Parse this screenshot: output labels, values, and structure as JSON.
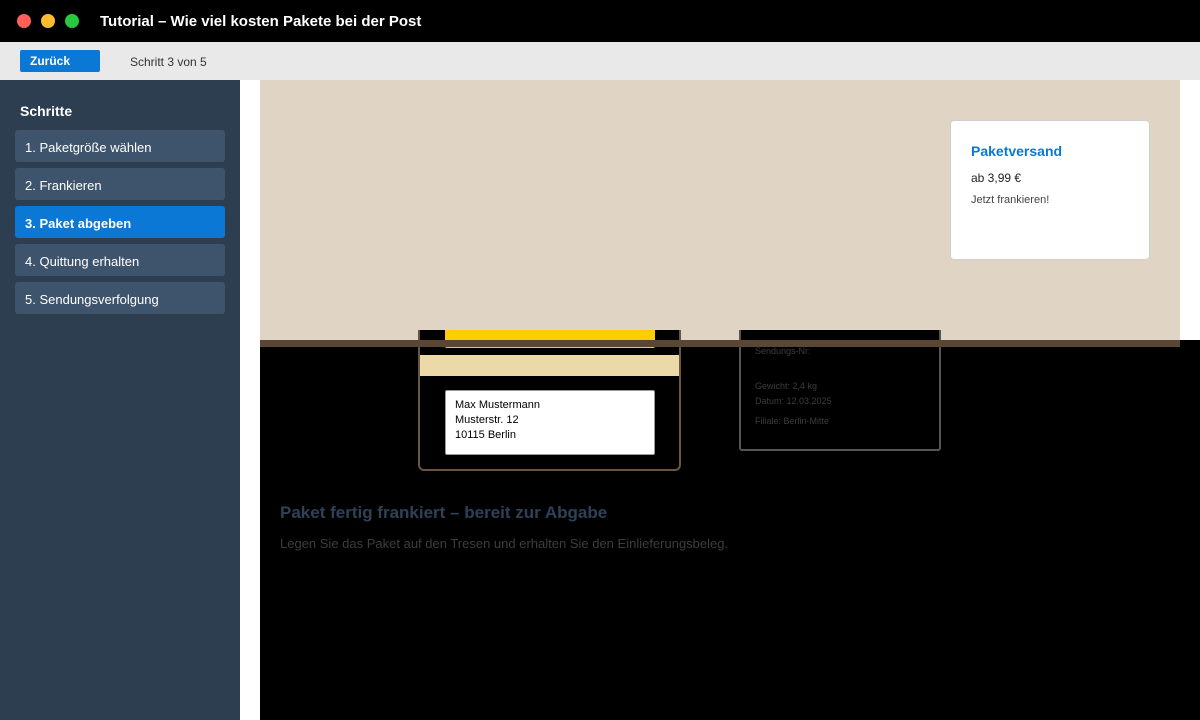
{
  "window": {
    "title": "Tutorial – Wie viel kosten Pakete bei der Post"
  },
  "toolbar": {
    "back_label": "Zurück",
    "step_indicator": "Schritt 3 von 5"
  },
  "sidebar": {
    "heading": "Schritte",
    "items": [
      {
        "label": "1. Paketgröße wählen",
        "active": false
      },
      {
        "label": "2. Frankieren",
        "active": false
      },
      {
        "label": "3. Paket abgeben",
        "active": true
      },
      {
        "label": "4. Quittung erhalten",
        "active": false
      },
      {
        "label": "5. Sendungsverfolgung",
        "active": false
      }
    ]
  },
  "promo": {
    "title": "Paketversand",
    "price": "ab 3,99 €",
    "cta": "Jetzt frankieren!"
  },
  "parcel": {
    "address_lines": [
      "Max Mustermann",
      "Musterstr. 12",
      "10115 Berlin"
    ]
  },
  "receipt": {
    "tracking": "Sendungs-Nr:",
    "weight": "Gewicht: 2,4 kg",
    "date": "Datum: 12.03.2025",
    "branch": "Filiale: Berlin-Mitte"
  },
  "message": {
    "title": "Paket fertig frankiert – bereit zur Abgabe",
    "subtitle": "Legen Sie das Paket auf den Tresen und erhalten Sie den Einlieferungsbeleg."
  },
  "colors": {
    "accent": "#0a78d4",
    "sidebar_bg": "#2c3e50",
    "hero_bg": "#e0d5c4",
    "stamp_yellow": "#ffcc00"
  }
}
